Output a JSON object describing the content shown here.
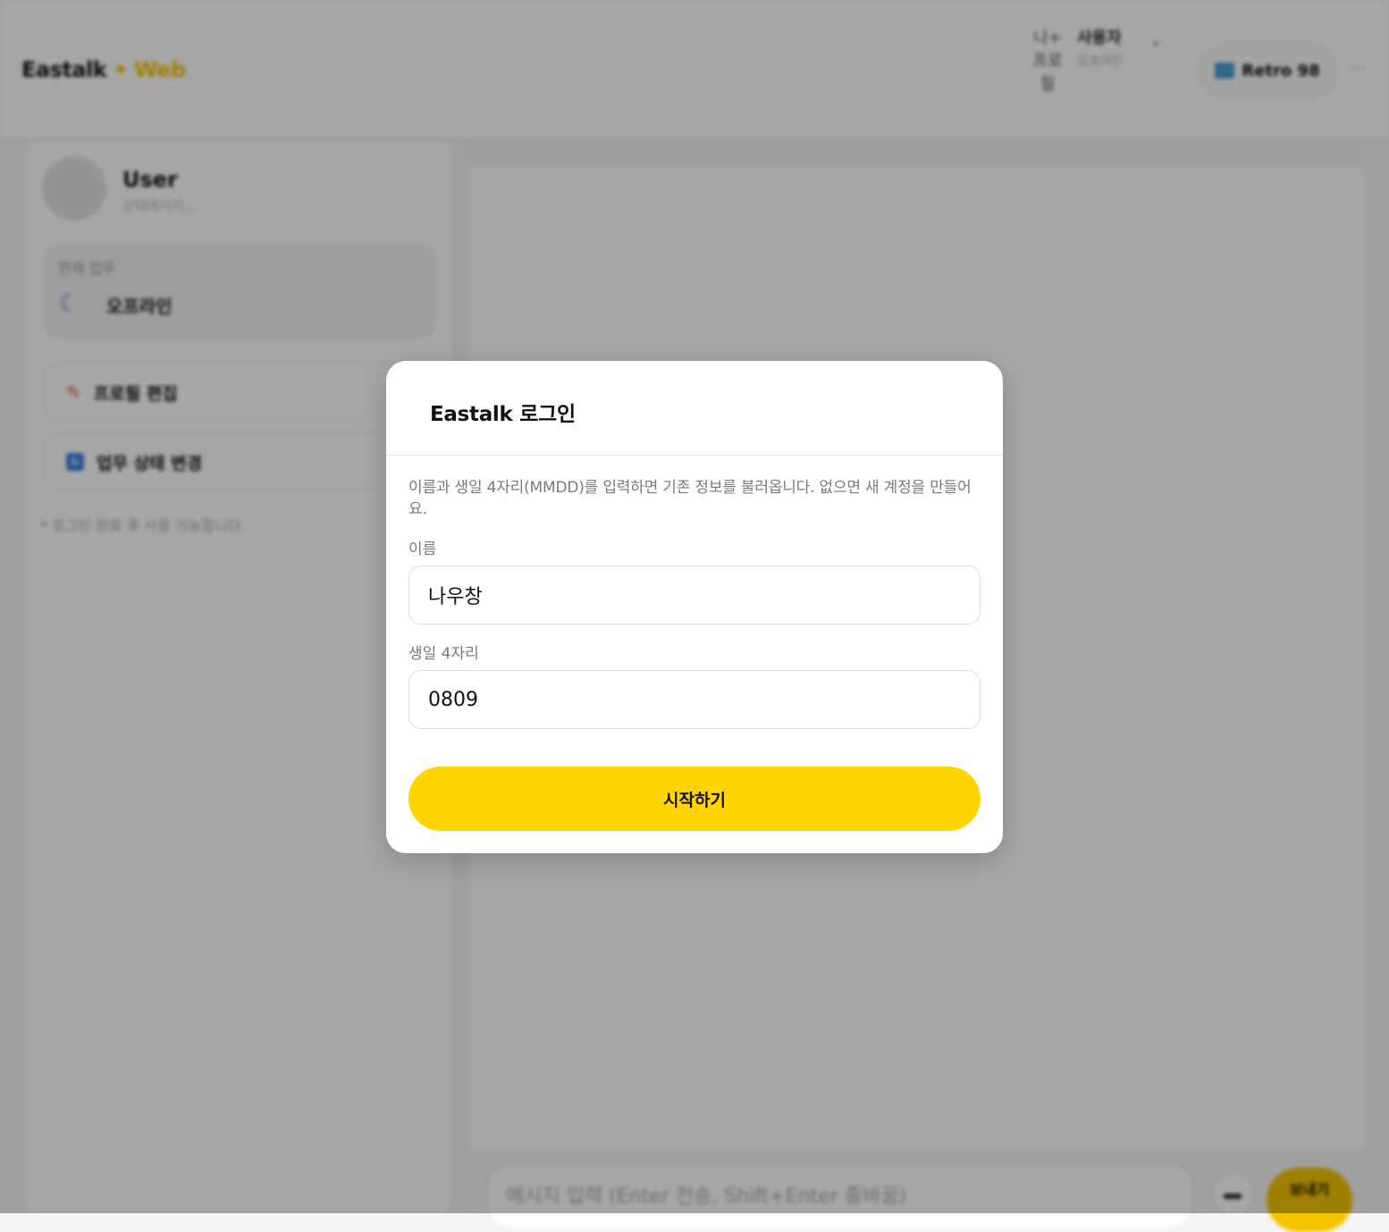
{
  "header": {
    "brand": "Eastalk",
    "brand_separator": "•",
    "brand_suffix": "Web",
    "avatar_alt": "나+ 프로필",
    "user_name": "사용자",
    "user_status": "오프라인",
    "theme_label": "Retro 98",
    "more": "···"
  },
  "sidebar": {
    "name": "User",
    "status_message": "상태메시지...",
    "work_label": "현재 업무",
    "work_value": "오프라인",
    "edit_profile": "프로필 편집",
    "change_status": "업무 상태 변경",
    "note": "* 로그인 완료 후 사용 가능합니다."
  },
  "chat": {
    "input_placeholder": "메시지 입력 (Enter 전송, Shift+Enter 줄바꿈)",
    "send_label": "보내기"
  },
  "modal": {
    "title": "Eastalk 로그인",
    "description": "이름과 생일 4자리(MMDD)를 입력하면 기존 정보를 불러옵니다. 없으면 새 계정을 만들어요.",
    "name_label": "이름",
    "name_value": "나우창",
    "birth_label": "생일 4자리",
    "birth_value": "0809",
    "start_button": "시작하기"
  },
  "colors": {
    "accent": "#ffd400",
    "overlay": "rgba(0,0,0,0.35)"
  }
}
